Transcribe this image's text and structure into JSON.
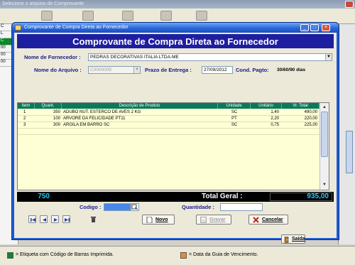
{
  "background_window": {
    "title": "Selecione o arquivo de Comprovante",
    "left_cells": [
      "C",
      "L",
      "C",
      "00",
      "00",
      "00"
    ]
  },
  "legend": {
    "green_label": "= Etiqueta com Código de Barras Imprimida.",
    "orange_label": "= Data da Guia de Vencimento.",
    "green_color": "#0a8a2a",
    "orange_color": "#ee8a2a"
  },
  "dialog": {
    "title": "Comprovante de Compra Direta ao Fornecedor",
    "header": "Comprovante de Compra Direta ao Fornecedor",
    "fornecedor_label": "Nome de Fornecedor :",
    "fornecedor_value": "PEDRAS DECORATIVAS ITALIA LTDA-ME",
    "arquivo_label": "Nome do Arquivo :",
    "arquivo_value": "C0000005",
    "prazo_label": "Prazo de Entrega :",
    "prazo_value": "27/09/2012",
    "cond_label": "Cond. Pagto:",
    "cond_value": "30/60/90 dias"
  },
  "grid": {
    "columns": [
      "Item",
      "Quant.",
      "Descrição de Produto",
      "Unidade",
      "Unitário",
      "Vr. Total"
    ],
    "rows": [
      {
        "item": "1",
        "quant": "350",
        "descricao": "ADUBO NUT. ESTERCO DE AVES 2 KG",
        "unidade": "SC",
        "unitario": "1,40",
        "total": "490,00"
      },
      {
        "item": "2",
        "quant": "100",
        "descricao": "ARVORE DA FELICIDADE PT11",
        "unidade": "PT",
        "unitario": "2,20",
        "total": "220,00"
      },
      {
        "item": "3",
        "quant": "300",
        "descricao": "ARGILA EM BARRO SC",
        "unidade": "SC",
        "unitario": "0,75",
        "total": "225,00"
      }
    ]
  },
  "totals": {
    "count": "750",
    "label": "Total Geral :",
    "value": "935,00"
  },
  "entry": {
    "codigo_label": "Codigo :",
    "quantidade_label": "Quantidade :",
    "codigo_value": "",
    "quantidade_value": ""
  },
  "buttons": {
    "novo": "Novo",
    "gravar": "Gravar",
    "cancelar": "Cancelar",
    "sair": "Saída"
  },
  "colors": {
    "header_band": "#1e1ea0",
    "grid_header": "#0a7a5a",
    "grid_bg": "#ffffd5",
    "total_value": "#1ec8ff"
  }
}
